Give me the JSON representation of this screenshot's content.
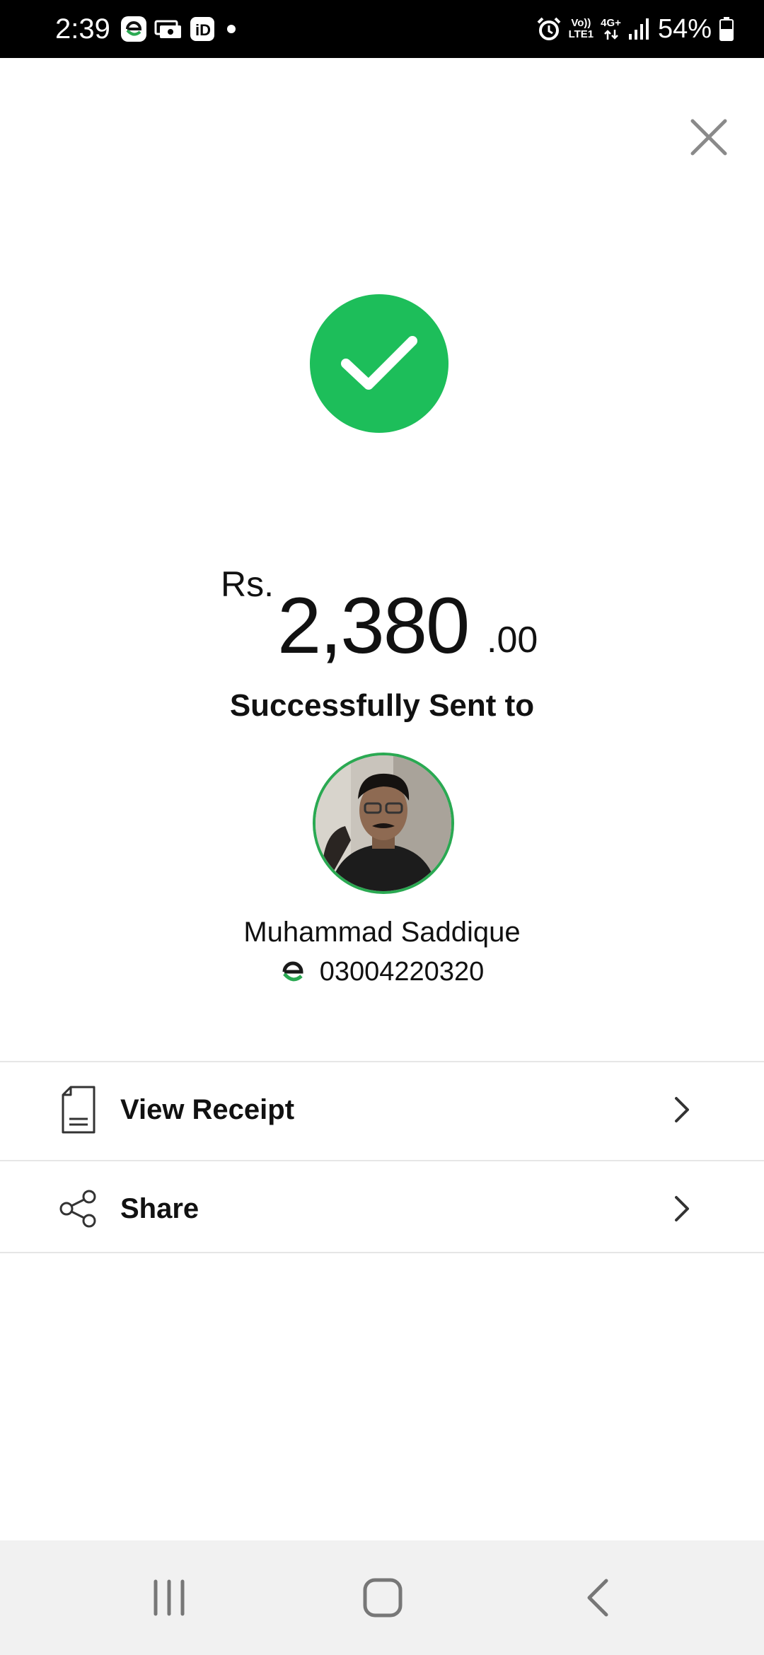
{
  "status_bar": {
    "time": "2:39",
    "network_top": "Vo))",
    "network_bottom": "LTE1",
    "network_type": "4G+",
    "battery": "54%",
    "notification_icons": [
      "easypaisa-icon",
      "cash-icon",
      "id-app-icon",
      "dot-icon"
    ],
    "status_icons": [
      "alarm-icon",
      "data-arrows-icon",
      "signal-icon",
      "battery-icon"
    ]
  },
  "close_icon": "close-icon",
  "success_icon": "checkmark-icon",
  "colors": {
    "success": "#1dbe5a",
    "avatar_ring": "#2aa952",
    "brand_green": "#2aa952"
  },
  "amount": {
    "currency": "Rs.",
    "value": "2,380",
    "decimal": ".00"
  },
  "sent_title": "Successfully Sent to",
  "recipient": {
    "name": "Muhammad Saddique",
    "number": "03004220320",
    "wallet_icon": "easypaisa-icon"
  },
  "actions": [
    {
      "label": "View Receipt",
      "icon": "receipt-icon"
    },
    {
      "label": "Share",
      "icon": "share-icon"
    }
  ],
  "nav": [
    "recents-icon",
    "home-icon",
    "back-icon"
  ]
}
